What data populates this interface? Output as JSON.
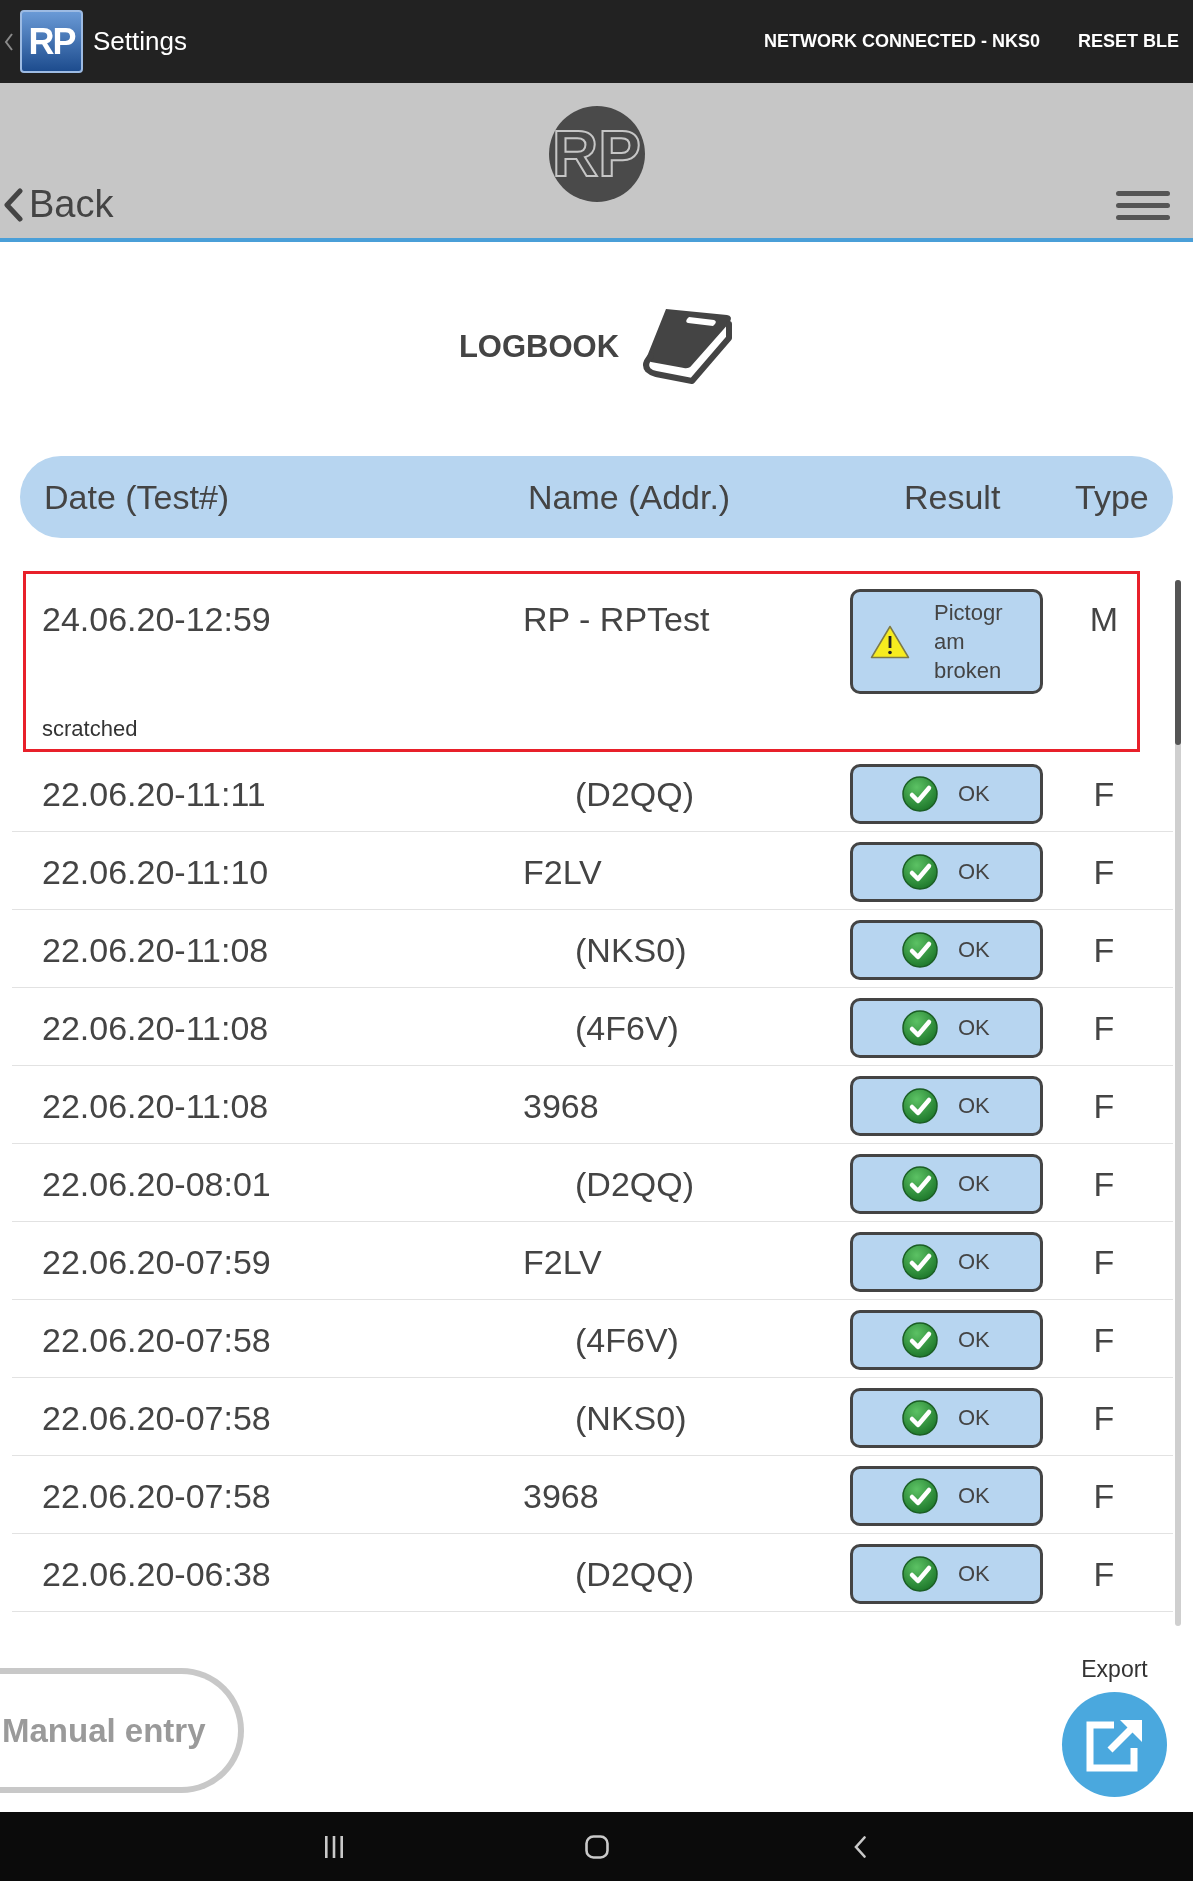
{
  "app_bar": {
    "logo_text": "RP",
    "title": "Settings",
    "status": "NETWORK CONNECTED - NKS0",
    "action": "RESET BLE"
  },
  "header": {
    "back": "Back",
    "logo_text": "RP"
  },
  "page_title": "LOGBOOK",
  "table": {
    "columns": [
      "Date (Test#)",
      "Name (Addr.)",
      "Result",
      "Type"
    ],
    "rows": [
      {
        "date": "24.06.20-12:59",
        "name": "RP - RPTest",
        "result": {
          "kind": "warning",
          "text": "Pictogram broken"
        },
        "type": "M",
        "note": "scratched",
        "selected": true
      },
      {
        "date": "22.06.20-11:11",
        "address": "(D2QQ)",
        "result": {
          "kind": "ok",
          "text": "OK"
        },
        "type": "F",
        "selected": false
      },
      {
        "date": "22.06.20-11:10",
        "name": "F2LV",
        "result": {
          "kind": "ok",
          "text": "OK"
        },
        "type": "F",
        "selected": false
      },
      {
        "date": "22.06.20-11:08",
        "address": "(NKS0)",
        "result": {
          "kind": "ok",
          "text": "OK"
        },
        "type": "F",
        "selected": false
      },
      {
        "date": "22.06.20-11:08",
        "address": "(4F6V)",
        "result": {
          "kind": "ok",
          "text": "OK"
        },
        "type": "F",
        "selected": false
      },
      {
        "date": "22.06.20-11:08",
        "name": "3968",
        "result": {
          "kind": "ok",
          "text": "OK"
        },
        "type": "F",
        "selected": false
      },
      {
        "date": "22.06.20-08:01",
        "address": "(D2QQ)",
        "result": {
          "kind": "ok",
          "text": "OK"
        },
        "type": "F",
        "selected": false
      },
      {
        "date": "22.06.20-07:59",
        "name": "F2LV",
        "result": {
          "kind": "ok",
          "text": "OK"
        },
        "type": "F",
        "selected": false
      },
      {
        "date": "22.06.20-07:58",
        "address": "(4F6V)",
        "result": {
          "kind": "ok",
          "text": "OK"
        },
        "type": "F",
        "selected": false
      },
      {
        "date": "22.06.20-07:58",
        "address": "(NKS0)",
        "result": {
          "kind": "ok",
          "text": "OK"
        },
        "type": "F",
        "selected": false
      },
      {
        "date": "22.06.20-07:58",
        "name": "3968",
        "result": {
          "kind": "ok",
          "text": "OK"
        },
        "type": "F",
        "selected": false
      },
      {
        "date": "22.06.20-06:38",
        "address": "(D2QQ)",
        "result": {
          "kind": "ok",
          "text": "OK"
        },
        "type": "F",
        "selected": false
      }
    ]
  },
  "manual_entry": "Manual entry",
  "export": "Export"
}
